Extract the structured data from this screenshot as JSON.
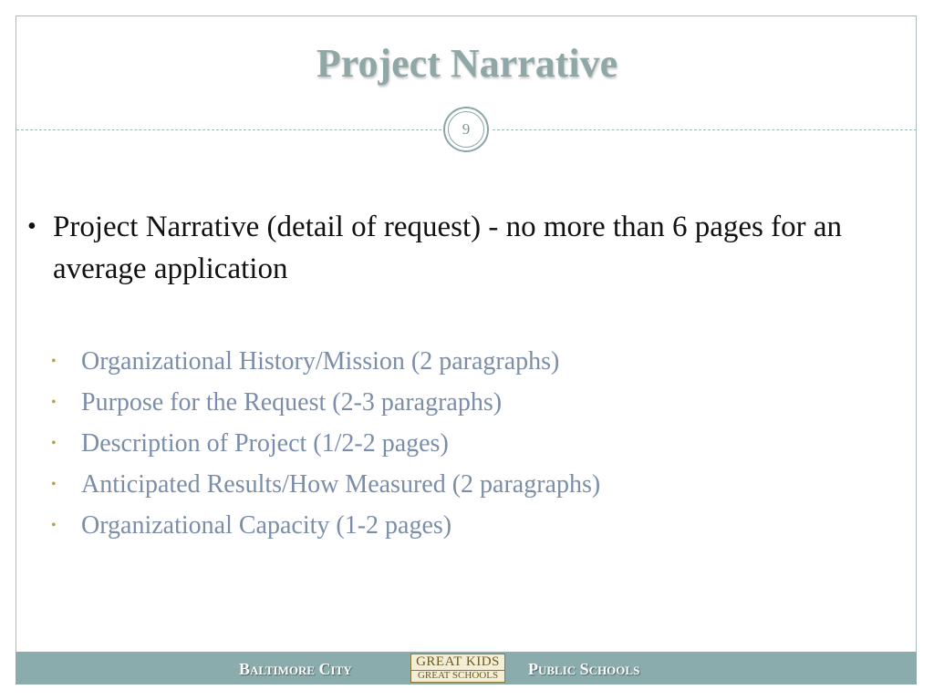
{
  "slide": {
    "title": "Project Narrative",
    "page_number": "9",
    "main_bullet": {
      "marker": "•",
      "text": "Project Narrative (detail of request) - no more than 6 pages for an average application"
    },
    "sub_bullets": [
      "Organizational History/Mission (2 paragraphs)",
      "Purpose for the Request (2-3 paragraphs)",
      "Description of Project (1/2-2 pages)",
      "Anticipated Results/How Measured (2 paragraphs)",
      "Organizational Capacity (1-2 pages)"
    ],
    "sub_marker": "•"
  },
  "footer": {
    "left_text": "Baltimore City",
    "right_text": "Public Schools",
    "logo": {
      "top_text": "GREAT KIDS",
      "bottom_text": "GREAT SCHOOLS"
    }
  },
  "colors": {
    "title": "#8fa7a7",
    "sub_text": "#7b8da9",
    "sub_bullet": "#b6a43a",
    "footer_bar": "#8aacad",
    "frame_border": "#a9bcbd"
  }
}
